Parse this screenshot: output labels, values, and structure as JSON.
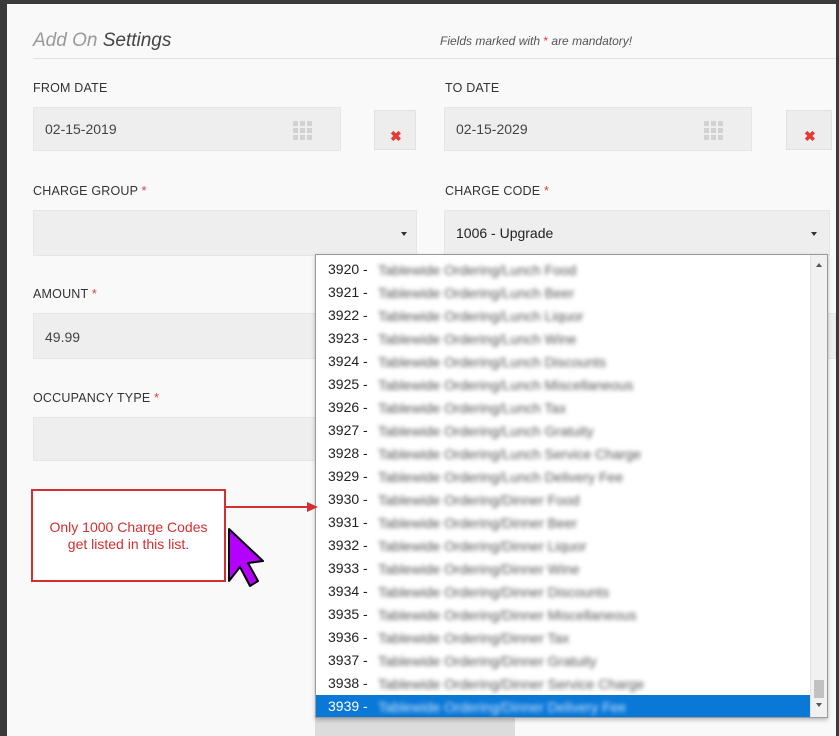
{
  "header": {
    "title_part1": "Add On",
    "title_part2": "Settings",
    "mandatory_note_prefix": "Fields marked with",
    "mandatory_star": "*",
    "mandatory_note_suffix": "are mandatory!"
  },
  "form": {
    "from_date": {
      "label": "FROM DATE",
      "value": "02-15-2019",
      "clear_icon": "close-icon"
    },
    "to_date": {
      "label": "TO DATE",
      "value": "02-15-2029",
      "clear_icon": "close-icon"
    },
    "charge_group": {
      "label": "CHARGE GROUP",
      "required_mark": "*",
      "value": ""
    },
    "charge_code": {
      "label": "CHARGE CODE",
      "required_mark": "*",
      "value": "1006 - Upgrade"
    },
    "amount": {
      "label": "AMOUNT",
      "required_mark": "*",
      "value": "49.99"
    },
    "occupancy_type": {
      "label": "OCCUPANCY TYPE",
      "required_mark": "*",
      "value": ""
    }
  },
  "dropdown": {
    "selected_index": 19,
    "items": [
      {
        "code": "3920 -",
        "name": "Tablewide Ordering/Lunch Food"
      },
      {
        "code": "3921 -",
        "name": "Tablewide Ordering/Lunch Beer"
      },
      {
        "code": "3922 -",
        "name": "Tablewide Ordering/Lunch Liquor"
      },
      {
        "code": "3923 -",
        "name": "Tablewide Ordering/Lunch Wine"
      },
      {
        "code": "3924 -",
        "name": "Tablewide Ordering/Lunch Discounts"
      },
      {
        "code": "3925 -",
        "name": "Tablewide Ordering/Lunch Miscellaneous"
      },
      {
        "code": "3926 -",
        "name": "Tablewide Ordering/Lunch Tax"
      },
      {
        "code": "3927 -",
        "name": "Tablewide Ordering/Lunch Gratuity"
      },
      {
        "code": "3928 -",
        "name": "Tablewide Ordering/Lunch Service Charge"
      },
      {
        "code": "3929 -",
        "name": "Tablewide Ordering/Lunch Delivery Fee"
      },
      {
        "code": "3930 -",
        "name": "Tablewide Ordering/Dinner Food"
      },
      {
        "code": "3931 -",
        "name": "Tablewide Ordering/Dinner Beer"
      },
      {
        "code": "3932 -",
        "name": "Tablewide Ordering/Dinner Liquor"
      },
      {
        "code": "3933 -",
        "name": "Tablewide Ordering/Dinner Wine"
      },
      {
        "code": "3934 -",
        "name": "Tablewide Ordering/Dinner Discounts"
      },
      {
        "code": "3935 -",
        "name": "Tablewide Ordering/Dinner Miscellaneous"
      },
      {
        "code": "3936 -",
        "name": "Tablewide Ordering/Dinner Tax"
      },
      {
        "code": "3937 -",
        "name": "Tablewide Ordering/Dinner Gratuity"
      },
      {
        "code": "3938 -",
        "name": "Tablewide Ordering/Dinner Service Charge"
      },
      {
        "code": "3939 -",
        "name": "Tablewide Ordering/Dinner Delivery Fee"
      }
    ]
  },
  "annotation": {
    "callout_text": "Only 1000 Charge Codes get listed in this list.",
    "border_color": "#d32f2f",
    "cursor_color": "#b400ff"
  },
  "colors": {
    "accent_selected": "#0a78d7",
    "required_star": "#e53935"
  }
}
